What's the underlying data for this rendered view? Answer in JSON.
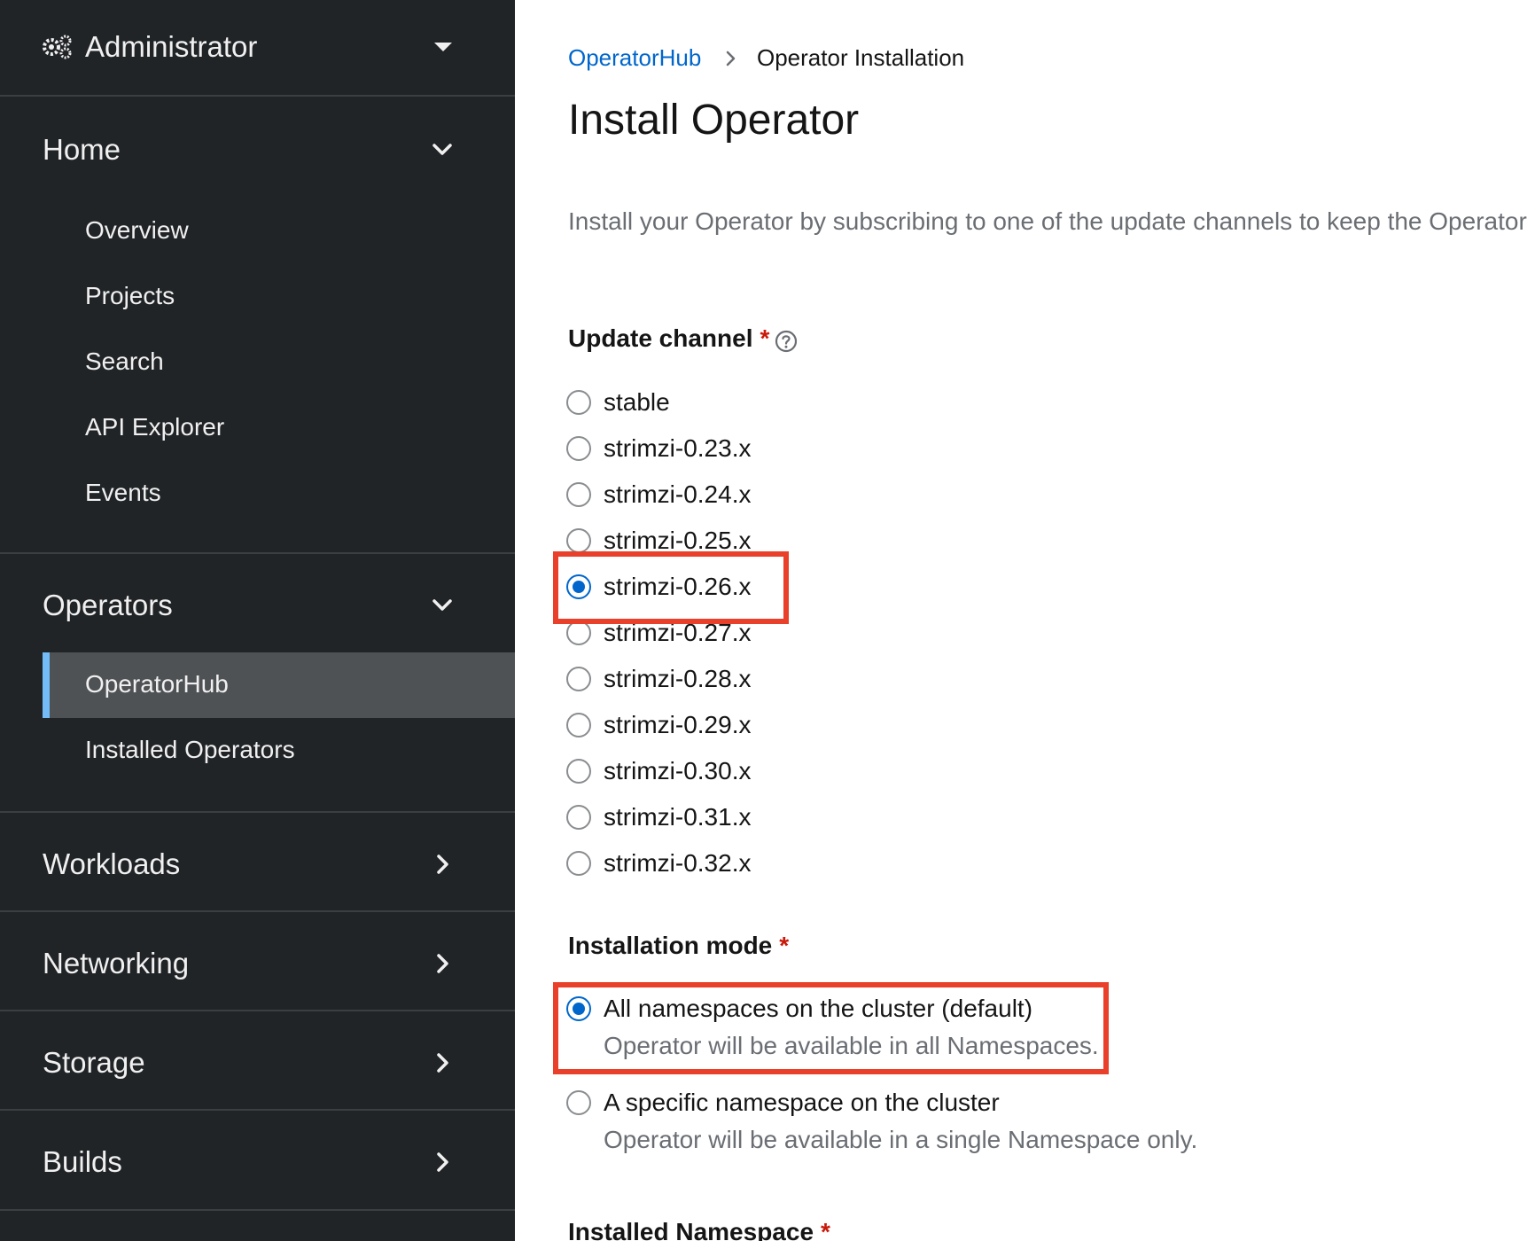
{
  "sidebar": {
    "perspective": {
      "label": "Administrator",
      "icon": "gears-icon",
      "caret_icon": "caret-down-icon"
    },
    "sections": {
      "home": {
        "label": "Home",
        "items": [
          "Overview",
          "Projects",
          "Search",
          "API Explorer",
          "Events"
        ]
      },
      "operators": {
        "label": "Operators",
        "items": [
          "OperatorHub",
          "Installed Operators"
        ],
        "active_item": "OperatorHub"
      },
      "workloads": {
        "label": "Workloads"
      },
      "networking": {
        "label": "Networking"
      },
      "storage": {
        "label": "Storage"
      },
      "builds": {
        "label": "Builds"
      }
    }
  },
  "breadcrumb": {
    "link": "OperatorHub",
    "current": "Operator Installation"
  },
  "page": {
    "title": "Install Operator",
    "intro": "Install your Operator by subscribing to one of the update channels to keep the Operator"
  },
  "update_channel": {
    "label": "Update channel",
    "required_mark": "*",
    "help_icon": "question-circle-icon",
    "options": [
      "stable",
      "strimzi-0.23.x",
      "strimzi-0.24.x",
      "strimzi-0.25.x",
      "strimzi-0.26.x",
      "strimzi-0.27.x",
      "strimzi-0.28.x",
      "strimzi-0.29.x",
      "strimzi-0.30.x",
      "strimzi-0.31.x",
      "strimzi-0.32.x"
    ],
    "selected": "strimzi-0.26.x"
  },
  "installation_mode": {
    "label": "Installation mode",
    "required_mark": "*",
    "options": [
      {
        "label": "All namespaces on the cluster (default)",
        "description": "Operator will be available in all Namespaces."
      },
      {
        "label": "A specific namespace on the cluster",
        "description": "Operator will be available in a single Namespace only."
      }
    ],
    "selected": "All namespaces on the cluster (default)"
  },
  "installed_namespace": {
    "label": "Installed Namespace",
    "required_mark": "*"
  },
  "colors": {
    "sidebar_bg": "#212427",
    "active_nav_bg": "#4f5255",
    "active_nav_accent": "#73bcf7",
    "link": "#0066cc",
    "required": "#c9190b",
    "highlight_box": "#e8402a"
  }
}
